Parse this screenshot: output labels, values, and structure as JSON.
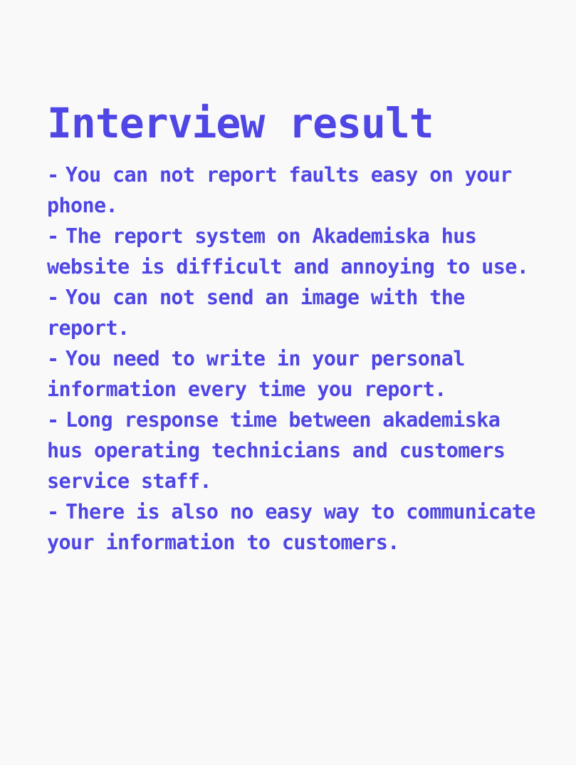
{
  "title": "Interview result",
  "findings": [
    {
      "marker": "-",
      "text": "You can not report faults easy on your phone."
    },
    {
      "marker": "-",
      "text": "The report system on Akademiska hus website is difficult and annoying to use."
    },
    {
      "marker": "-",
      "text": "You can not send an image with the report."
    },
    {
      "marker": "-",
      "text": "You need to write in your personal information every time you report."
    },
    {
      "marker": "-",
      "text": "Long response time between akademiska hus operating technicians and customers service staff."
    },
    {
      "marker": "-",
      "text": "There is also no easy way to communicate your information to customers."
    }
  ],
  "colors": {
    "background": "#f9f9f9",
    "text": "#4f46e5"
  }
}
